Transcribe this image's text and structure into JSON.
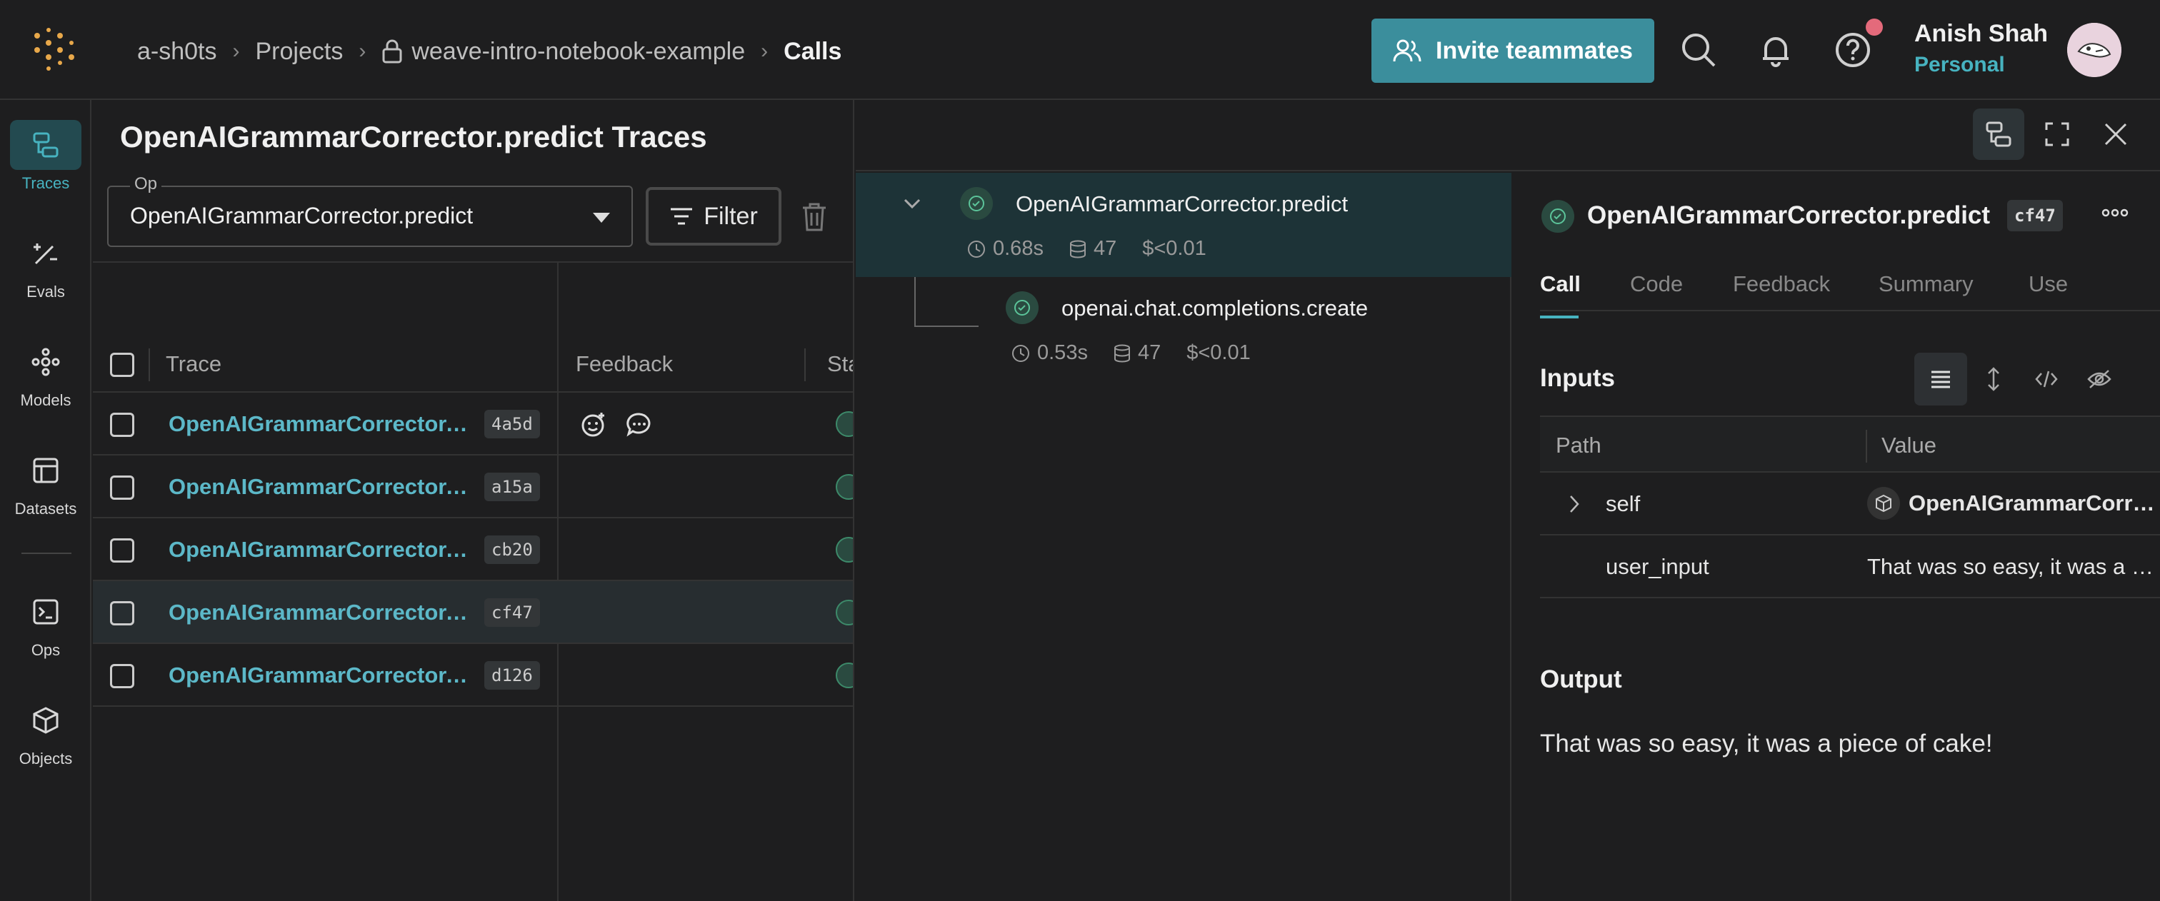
{
  "breadcrumb": {
    "entity": "a-sh0ts",
    "projects": "Projects",
    "project": "weave-intro-notebook-example",
    "current": "Calls"
  },
  "header": {
    "invite_label": "Invite teammates",
    "user_name": "Anish Shah",
    "user_sub": "Personal"
  },
  "sidebar": {
    "items": [
      {
        "label": "Traces",
        "icon": "traces-icon"
      },
      {
        "label": "Evals",
        "icon": "evals-icon"
      },
      {
        "label": "Models",
        "icon": "models-icon"
      },
      {
        "label": "Datasets",
        "icon": "datasets-icon"
      },
      {
        "label": "Ops",
        "icon": "ops-icon"
      },
      {
        "label": "Objects",
        "icon": "objects-icon"
      }
    ]
  },
  "traces_panel": {
    "title": "OpenAIGrammarCorrector.predict Traces",
    "op_label": "Op",
    "op_value": "OpenAIGrammarCorrector.predict",
    "filter_label": "Filter",
    "columns": {
      "trace": "Trace",
      "feedback": "Feedback",
      "status": "Sta"
    },
    "rows": [
      {
        "name": "OpenAIGrammarCorrector.predict",
        "id": "4a5d"
      },
      {
        "name": "OpenAIGrammarCorrector.predict",
        "id": "a15a"
      },
      {
        "name": "OpenAIGrammarCorrector.predict",
        "id": "cb20"
      },
      {
        "name": "OpenAIGrammarCorrector.predict",
        "id": "cf47"
      },
      {
        "name": "OpenAIGrammarCorrector.predict",
        "id": "d126"
      }
    ]
  },
  "call_tree": {
    "root": {
      "name": "OpenAIGrammarCorrector.predict",
      "latency": "0.68s",
      "tokens": "47",
      "cost": "$<0.01"
    },
    "child": {
      "name": "openai.chat.completions.create",
      "latency": "0.53s",
      "tokens": "47",
      "cost": "$<0.01"
    }
  },
  "call_detail": {
    "title": "OpenAIGrammarCorrector.predict",
    "id": "cf47",
    "tabs": [
      "Call",
      "Code",
      "Feedback",
      "Summary",
      "Use"
    ],
    "inputs_title": "Inputs",
    "path_header": "Path",
    "value_header": "Value",
    "inputs": [
      {
        "key": "self",
        "value": "OpenAIGrammarCorrector"
      },
      {
        "key": "user_input",
        "value": "That was so easy, it was a piece of cake!"
      }
    ],
    "output_title": "Output",
    "output_value": "That was so easy, it was a piece of cake!"
  },
  "colors": {
    "accent": "#47b3c0",
    "invite_bg": "#3b8e9c",
    "link": "#5cb8c8",
    "notification": "#e46a7b"
  }
}
